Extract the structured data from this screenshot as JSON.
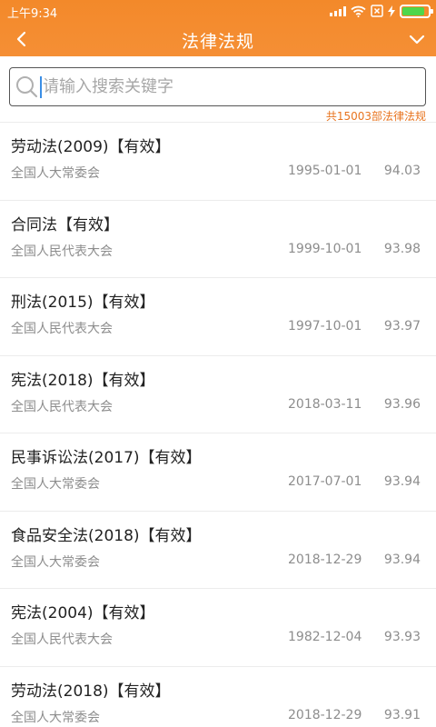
{
  "status_bar": {
    "time": "上午9:34",
    "battery_level": 0.92
  },
  "nav": {
    "title": "法律法规"
  },
  "search": {
    "placeholder": "请输入搜索关键字",
    "value": ""
  },
  "summary": {
    "count_text": "共15003部法律法规"
  },
  "colors": {
    "header": "#f58f35",
    "accent_text": "#e8741f",
    "battery": "#4fd64a"
  },
  "laws": [
    {
      "title": "劳动法(2009)【有效】",
      "org": "全国人大常委会",
      "date": "1995-01-01",
      "score": "94.03"
    },
    {
      "title": "合同法【有效】",
      "org": "全国人民代表大会",
      "date": "1999-10-01",
      "score": "93.98"
    },
    {
      "title": "刑法(2015)【有效】",
      "org": "全国人民代表大会",
      "date": "1997-10-01",
      "score": "93.97"
    },
    {
      "title": "宪法(2018)【有效】",
      "org": "全国人民代表大会",
      "date": "2018-03-11",
      "score": "93.96"
    },
    {
      "title": "民事诉讼法(2017)【有效】",
      "org": "全国人大常委会",
      "date": "2017-07-01",
      "score": "93.94"
    },
    {
      "title": "食品安全法(2018)【有效】",
      "org": "全国人大常委会",
      "date": "2018-12-29",
      "score": "93.94"
    },
    {
      "title": "宪法(2004)【有效】",
      "org": "全国人民代表大会",
      "date": "1982-12-04",
      "score": "93.93"
    },
    {
      "title": "劳动法(2018)【有效】",
      "org": "全国人大常委会",
      "date": "2018-12-29",
      "score": "93.91"
    }
  ]
}
